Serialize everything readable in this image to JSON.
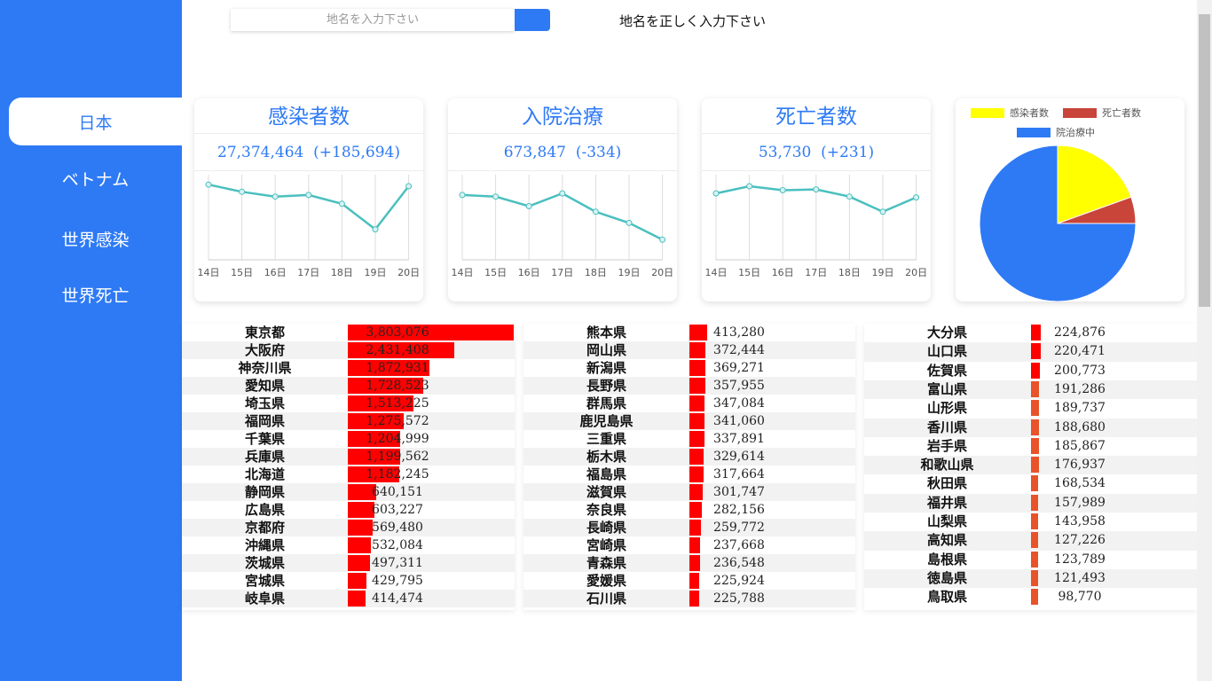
{
  "search": {
    "placeholder": "地名を入力下さい",
    "hint": "地名を正しく入力下さい"
  },
  "nav": [
    {
      "label": "日本",
      "active": true
    },
    {
      "label": "ベトナム",
      "active": false
    },
    {
      "label": "世界感染",
      "active": false
    },
    {
      "label": "世界死亡",
      "active": false
    }
  ],
  "cards": [
    {
      "title": "感染者数",
      "value": "27,374,464",
      "change": "(+185,694)",
      "chart_data": {
        "type": "line",
        "categories": [
          "14日",
          "15日",
          "16日",
          "17日",
          "18日",
          "19日",
          "20日"
        ],
        "values": [
          0.92,
          0.83,
          0.77,
          0.79,
          0.68,
          0.36,
          0.9
        ]
      }
    },
    {
      "title": "入院治療",
      "value": "673,847",
      "change": "(-334)",
      "chart_data": {
        "type": "line",
        "categories": [
          "14日",
          "15日",
          "16日",
          "17日",
          "18日",
          "19日",
          "20日"
        ],
        "values": [
          0.79,
          0.77,
          0.65,
          0.81,
          0.58,
          0.44,
          0.23
        ]
      }
    },
    {
      "title": "死亡者数",
      "value": "53,730",
      "change": "(+231)",
      "chart_data": {
        "type": "line",
        "categories": [
          "14日",
          "15日",
          "16日",
          "17日",
          "18日",
          "19日",
          "20日"
        ],
        "values": [
          0.81,
          0.9,
          0.85,
          0.86,
          0.77,
          0.58,
          0.76
        ]
      }
    }
  ],
  "pie": {
    "chart_data": {
      "type": "pie",
      "legend": [
        "感染者数",
        "死亡者数",
        "院治療中"
      ],
      "colors": [
        "#ffff00",
        "#c9453a",
        "#2e7af5"
      ],
      "values": [
        19.5,
        5.5,
        75.0
      ]
    }
  },
  "colors": {
    "accent": "#2e7af5",
    "bar_red": "#ff0000",
    "bar_orange": "#e8532a",
    "line": "#4bbfbf"
  },
  "tables": [
    {
      "rows": [
        {
          "name": "東京都",
          "value": "3,803,076"
        },
        {
          "name": "大阪府",
          "value": "2,431,408"
        },
        {
          "name": "神奈川県",
          "value": "1,872,931"
        },
        {
          "name": "愛知県",
          "value": "1,728,523"
        },
        {
          "name": "埼玉県",
          "value": "1,513,225"
        },
        {
          "name": "福岡県",
          "value": "1,275,572"
        },
        {
          "name": "千葉県",
          "value": "1,204,999"
        },
        {
          "name": "兵庫県",
          "value": "1,199,562"
        },
        {
          "name": "北海道",
          "value": "1,182,245"
        },
        {
          "name": "静岡県",
          "value": "640,151"
        },
        {
          "name": "広島県",
          "value": "603,227"
        },
        {
          "name": "京都府",
          "value": "569,480"
        },
        {
          "name": "沖縄県",
          "value": "532,084"
        },
        {
          "name": "茨城県",
          "value": "497,311"
        },
        {
          "name": "宮城県",
          "value": "429,795"
        },
        {
          "name": "岐阜県",
          "value": "414,474"
        }
      ]
    },
    {
      "rows": [
        {
          "name": "熊本県",
          "value": "413,280"
        },
        {
          "name": "岡山県",
          "value": "372,444"
        },
        {
          "name": "新潟県",
          "value": "369,271"
        },
        {
          "name": "長野県",
          "value": "357,955"
        },
        {
          "name": "群馬県",
          "value": "347,084"
        },
        {
          "name": "鹿児島県",
          "value": "341,060"
        },
        {
          "name": "三重県",
          "value": "337,891"
        },
        {
          "name": "栃木県",
          "value": "329,614"
        },
        {
          "name": "福島県",
          "value": "317,664"
        },
        {
          "name": "滋賀県",
          "value": "301,747"
        },
        {
          "name": "奈良県",
          "value": "282,156"
        },
        {
          "name": "長崎県",
          "value": "259,772"
        },
        {
          "name": "宮崎県",
          "value": "237,668"
        },
        {
          "name": "青森県",
          "value": "236,548"
        },
        {
          "name": "愛媛県",
          "value": "225,924"
        },
        {
          "name": "石川県",
          "value": "225,788"
        }
      ]
    },
    {
      "rows": [
        {
          "name": "大分県",
          "value": "224,876"
        },
        {
          "name": "山口県",
          "value": "220,471"
        },
        {
          "name": "佐賀県",
          "value": "200,773"
        },
        {
          "name": "富山県",
          "value": "191,286"
        },
        {
          "name": "山形県",
          "value": "189,737"
        },
        {
          "name": "香川県",
          "value": "188,680"
        },
        {
          "name": "岩手県",
          "value": "185,867"
        },
        {
          "name": "和歌山県",
          "value": "176,937"
        },
        {
          "name": "秋田県",
          "value": "168,534"
        },
        {
          "name": "福井県",
          "value": "157,989"
        },
        {
          "name": "山梨県",
          "value": "143,958"
        },
        {
          "name": "高知県",
          "value": "127,226"
        },
        {
          "name": "島根県",
          "value": "123,789"
        },
        {
          "name": "徳島県",
          "value": "121,493"
        },
        {
          "name": "鳥取県",
          "value": "98,770"
        }
      ]
    }
  ]
}
